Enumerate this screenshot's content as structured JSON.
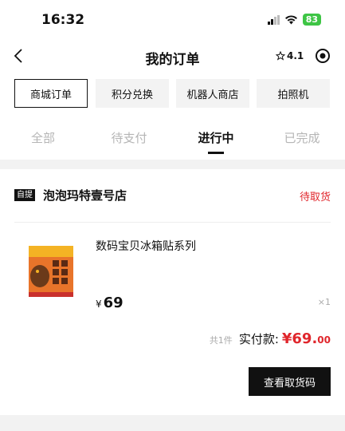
{
  "status_bar": {
    "time": "16:32",
    "battery": "83"
  },
  "nav": {
    "title": "我的订单",
    "rating": "4.1"
  },
  "type_tabs": [
    {
      "label": "商城订单"
    },
    {
      "label": "积分兑换"
    },
    {
      "label": "机器人商店"
    },
    {
      "label": "拍照机"
    }
  ],
  "status_tabs": [
    {
      "label": "全部"
    },
    {
      "label": "待支付"
    },
    {
      "label": "进行中"
    },
    {
      "label": "已完成"
    }
  ],
  "order": {
    "badge": "自提",
    "store_name": "泡泡玛特壹号店",
    "status": "待取货",
    "product_name": "数码宝贝冰箱贴系列",
    "currency": "¥",
    "price": "69",
    "quantity": "×1",
    "total_count": "共1件",
    "total_label": "实付款:",
    "total_integer": "¥69.",
    "total_decimal": "00",
    "pickup_button": "查看取货码"
  },
  "colors": {
    "accent_red": "#e0262c",
    "battery_green": "#3ec545"
  }
}
